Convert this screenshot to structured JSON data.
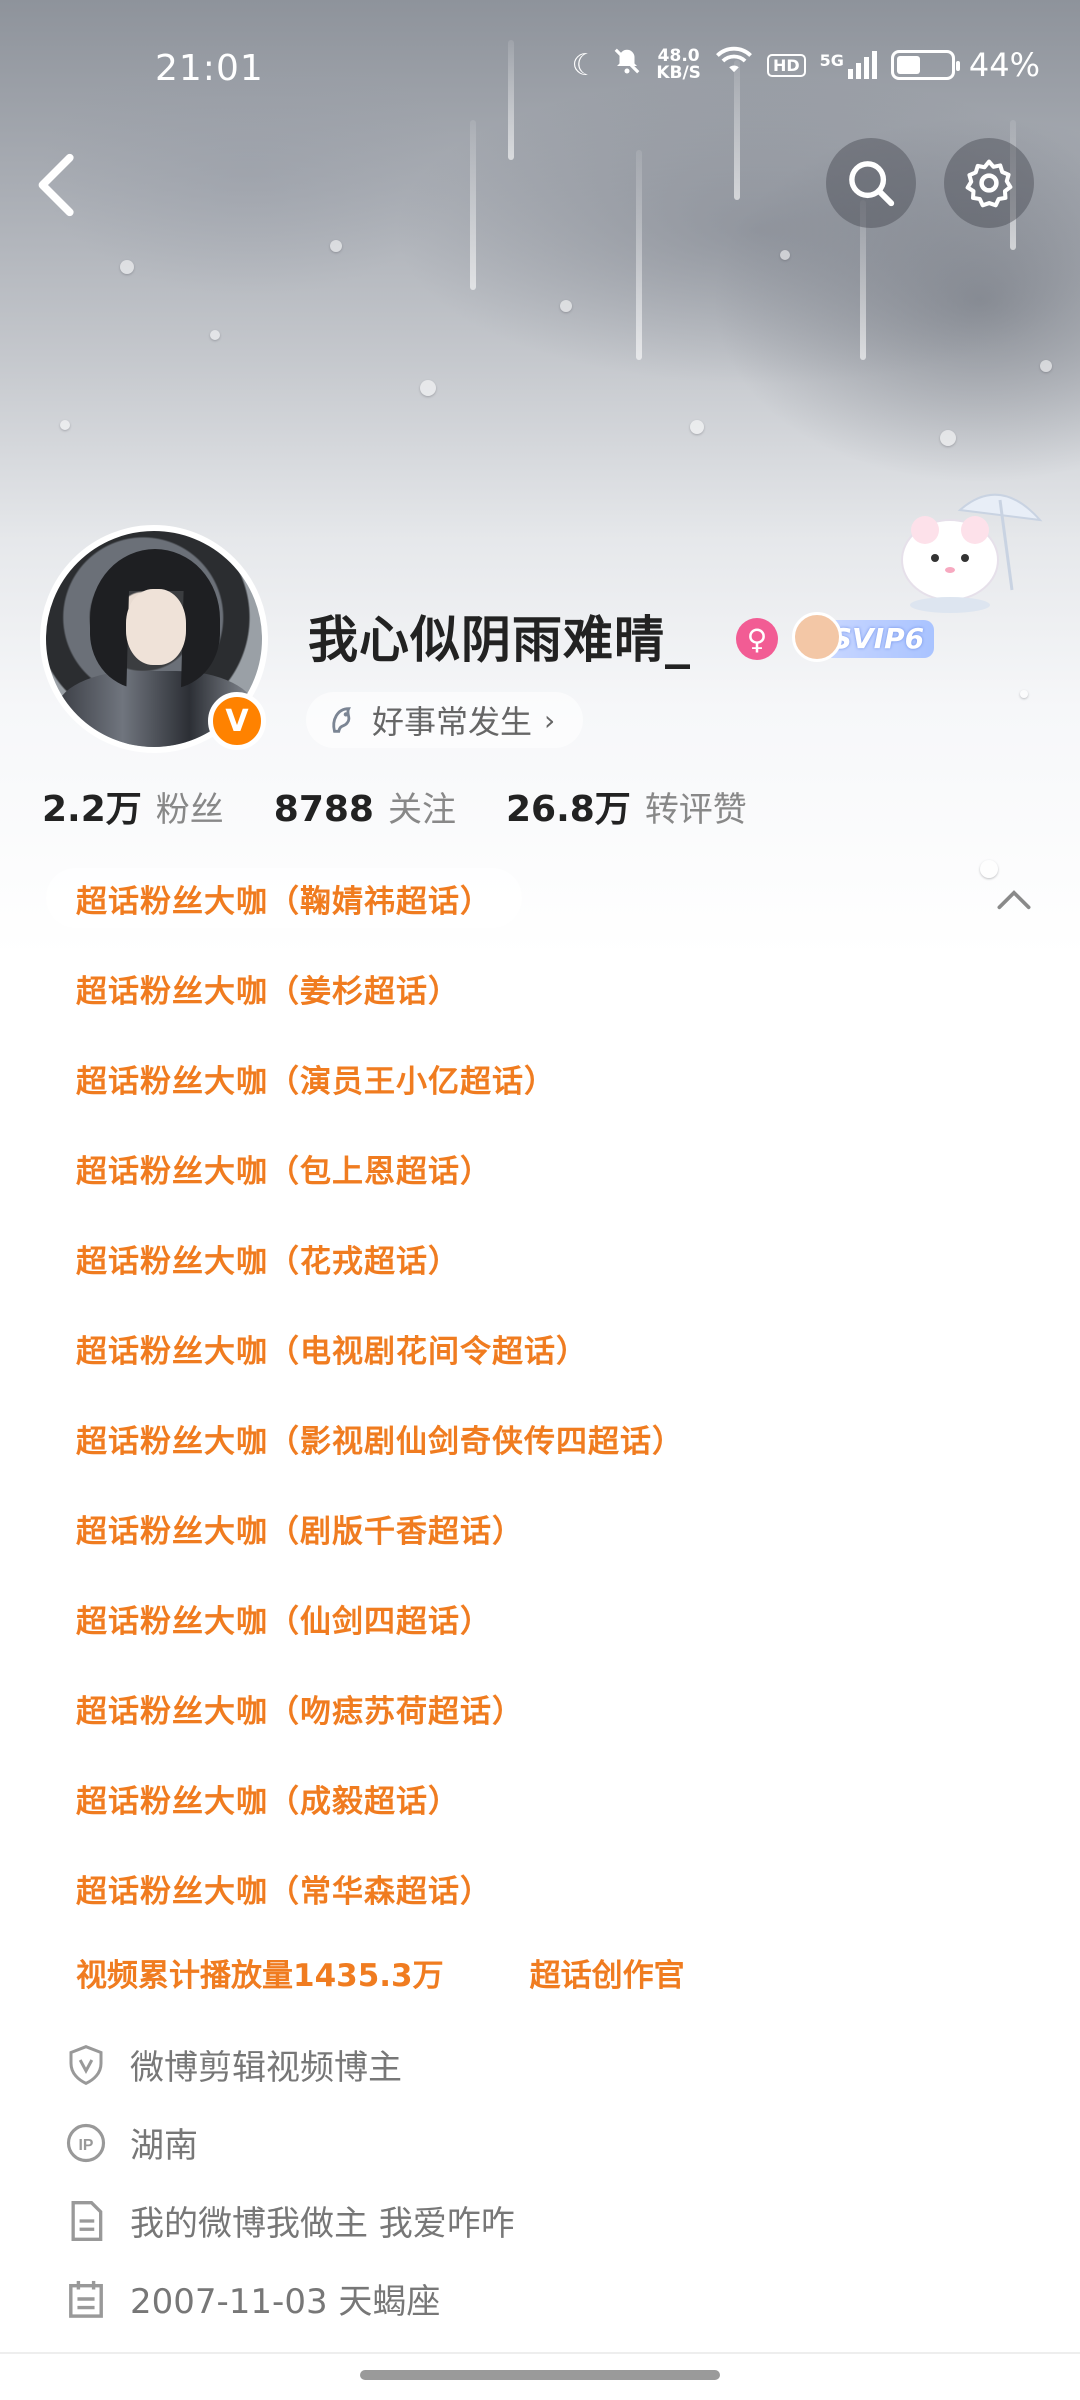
{
  "status_bar": {
    "time": "21:01",
    "net_speed_value": "48.0",
    "net_speed_unit": "KB/S",
    "hd_label": "HD",
    "network_label": "5G",
    "battery_percent": "44%",
    "battery_level": 0.44
  },
  "header": {
    "back_icon": "chevron-left-icon",
    "search_icon": "search-icon",
    "settings_icon": "gear-icon"
  },
  "profile": {
    "name": "我心似阴雨难晴_",
    "verified_badge": "V",
    "gender_symbol": "♀",
    "svip_label": "SVIP6",
    "motto": "好事常发生",
    "stats": [
      {
        "value": "2.2万",
        "label": "粉丝"
      },
      {
        "value": "8788",
        "label": "关注"
      },
      {
        "value": "26.8万",
        "label": "转评赞"
      }
    ]
  },
  "badges": [
    "超话粉丝大咖（鞠婧祎超话）",
    "超话粉丝大咖（姜杉超话）",
    "超话粉丝大咖（演员王小亿超话）",
    "超话粉丝大咖（包上恩超话）",
    "超话粉丝大咖（花戎超话）",
    "超话粉丝大咖（电视剧花间令超话）",
    "超话粉丝大咖（影视剧仙剑奇侠传四超话）",
    "超话粉丝大咖（剧版千香超话）",
    "超话粉丝大咖（仙剑四超话）",
    "超话粉丝大咖（吻痣苏荷超话）",
    "超话粉丝大咖（成毅超话）",
    "超话粉丝大咖（常华森超话）"
  ],
  "extra_badges": [
    "视频累计播放量1435.3万",
    "超话创作官"
  ],
  "info": [
    {
      "icon": "shield-v-icon",
      "text": "微博剪辑视频博主"
    },
    {
      "icon": "ip-icon",
      "text": "湖南"
    },
    {
      "icon": "document-icon",
      "text": "我的微博我做主 我爱咋咋"
    },
    {
      "icon": "calendar-icon",
      "text": "2007-11-03 天蝎座"
    }
  ],
  "colors": {
    "accent_orange": "#f07c20",
    "verified_orange": "#ff8200",
    "gender_pink": "#f25c94"
  }
}
